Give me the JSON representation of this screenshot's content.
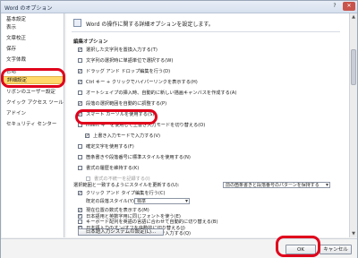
{
  "window": {
    "title": "Word のオプション",
    "help": "?",
    "close": "✕"
  },
  "sidebar": {
    "items": [
      {
        "label": "基本設定"
      },
      {
        "label": "表示"
      },
      {
        "label": "文章校正"
      },
      {
        "label": "保存"
      },
      {
        "label": "文字体裁"
      },
      {
        "label": "言語"
      },
      {
        "label": "詳細設定",
        "selected": true
      },
      {
        "label": "リボンのユーザー設定"
      },
      {
        "label": "クイック アクセス ツール バー"
      },
      {
        "label": "アドイン"
      },
      {
        "label": "セキュリティ センター"
      }
    ]
  },
  "header": {
    "text": "Word の操作に関する詳細オプションを設定します。"
  },
  "section": {
    "title": "編集オプション"
  },
  "options": [
    {
      "label": "選択した文字列を置換入力する(T)",
      "checked": true
    },
    {
      "label": "文字列の選択時に単語単位で選択する(W)",
      "checked": false
    },
    {
      "label": "ドラッグ アンド ドロップ編集を行う(D)",
      "checked": true
    },
    {
      "label": "Ctrl キー + クリックでハイパーリンクを表示する(H)",
      "checked": true
    },
    {
      "label": "オートシェイプの挿入時、自動的に新しい描画キャンバスを作成する(A)",
      "checked": false
    },
    {
      "label": "段落の選択範囲を自動的に調整する(P)",
      "checked": true
    },
    {
      "label": "スマート カーソルを使用する(S)",
      "checked": true
    },
    {
      "label": "Insert キーを使用して上書き入力モードを切り替える(O)",
      "checked": false
    },
    {
      "label": "上書き入力モードで入力する(V)",
      "checked": true
    },
    {
      "label": "確定文字を使用する(F)",
      "checked": false
    },
    {
      "label": "箇条書きや段落番号に標準スタイルを使用する(N)",
      "checked": false
    },
    {
      "label": "書式の履歴を維持する(K)",
      "checked": false
    },
    {
      "label": "書式の不統一を記録する(I)",
      "checked": false,
      "disabled": true
    }
  ],
  "paste_style": {
    "label": "選択範囲と一致するようにスタイルを更新する(U):",
    "value": "前の箇条書きと段落番号のパターンを保持する"
  },
  "click_and_type": {
    "label": "クリック アンド タイプ編集を行う(C)",
    "checked": true
  },
  "default_para_style": {
    "label": "既定の段落スタイル(Y):",
    "value": "標準"
  },
  "more_options": [
    {
      "label": "現在位置の数式を表示する(M)",
      "checked": true
    },
    {
      "label": "日本語用と英数字用に同じフォントを使う(E)",
      "checked": true
    },
    {
      "label": "キーボード配列を英語の言語に合わせて自動的に切り替える(B)",
      "checked": false
    },
    {
      "label": "日本語入力のオン/オフを自動的に切り替える(J)",
      "checked": true
    },
    {
      "label": "変換中の文字列を文書に挿入モードで入力する(Q)",
      "checked": true
    }
  ],
  "ime_button": {
    "label": "日本語入力システムの設定(L)..."
  },
  "footer": {
    "ok": "OK",
    "cancel": "キャンセル"
  },
  "colors": {
    "highlight": "#e0001b",
    "selected_nav": "#ffd969"
  }
}
